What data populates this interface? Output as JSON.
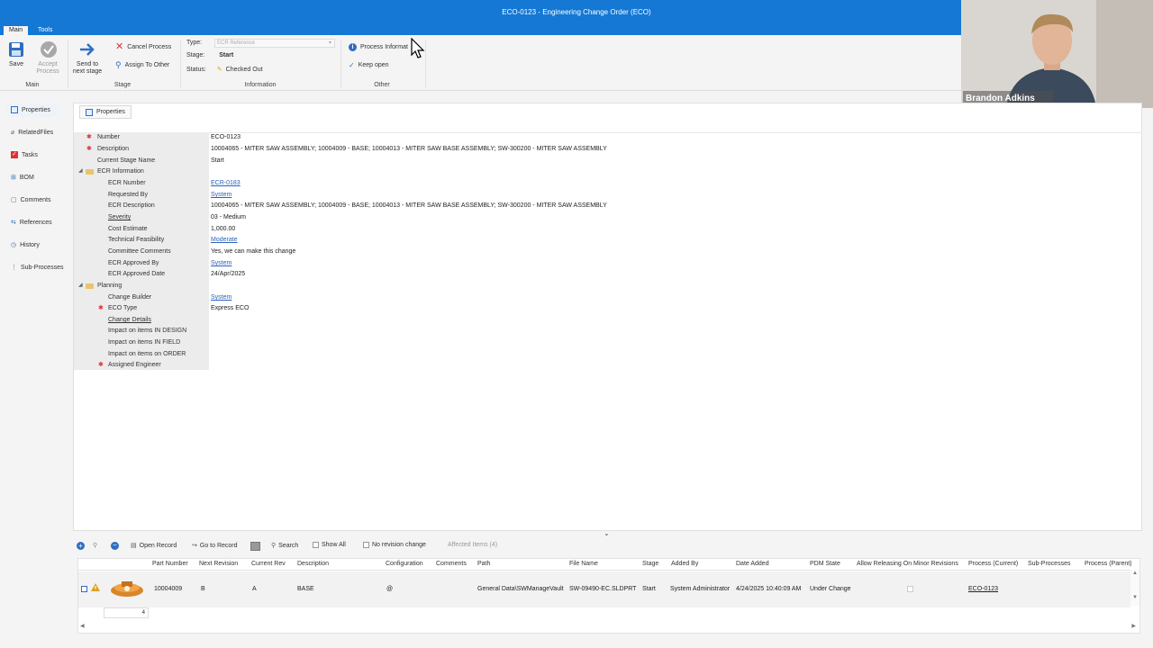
{
  "window": {
    "title": "ECO-0123 - Engineering Change Order (ECO)"
  },
  "menu_tabs": [
    "Main",
    "Tools"
  ],
  "ribbon": {
    "save": "Save",
    "accept": "Accept Process",
    "send": "Send to next stage",
    "cancel_process": "Cancel Process",
    "assign_other": "Assign To Other",
    "type_label": "Type:",
    "type_value": "ECR Reference",
    "stage_label": "Stage:",
    "stage_value": "Start",
    "status_label": "Status:",
    "status_value": "Checked Out",
    "process_info": "Process Informat",
    "keep_open": "Keep open",
    "groups": {
      "main": "Main",
      "stage": "Stage",
      "information": "Information",
      "other": "Other"
    }
  },
  "video": {
    "name": "Brandon Adkins"
  },
  "sidebar": {
    "items": [
      "Properties",
      "RelatedFiles",
      "Tasks",
      "BOM",
      "Comments",
      "References",
      "History",
      "Sub-Processes"
    ]
  },
  "properties_tab": "Properties",
  "props": {
    "number_lbl": "Number",
    "number_val": "ECO-0123",
    "desc_lbl": "Description",
    "desc_val": "10004065 - MITER SAW ASSEMBLY; 10004009 - BASE; 10004013 - MITER SAW BASE ASSEMBLY; SW-300200 - MITER SAW ASSEMBLY",
    "stage_lbl": "Current Stage Name",
    "stage_val": "Start",
    "ecr_info": "ECR Information",
    "ecr_num_lbl": "ECR Number",
    "ecr_num_val": "ECR-0183",
    "req_lbl": "Requested By",
    "req_val": "System",
    "ecr_desc_lbl": "ECR Description",
    "ecr_desc_val": "10004065 - MITER SAW ASSEMBLY; 10004009 - BASE; 10004013 - MITER SAW BASE ASSEMBLY; SW-300200 - MITER SAW ASSEMBLY",
    "sev_lbl": "Severity",
    "sev_val": "03 - Medium",
    "cost_lbl": "Cost Estimate",
    "cost_val": "1,000.00",
    "tech_lbl": "Technical Feasibility",
    "tech_val": "Moderate",
    "comm_lbl": "Committee Comments",
    "comm_val": "Yes, we can make this change",
    "appr_by_lbl": "ECR Approved By",
    "appr_by_val": "System",
    "appr_date_lbl": "ECR Approved Date",
    "appr_date_val": "24/Apr/2025",
    "planning": "Planning",
    "builder_lbl": "Change Builder",
    "builder_val": "System",
    "eco_type_lbl": "ECO Type",
    "eco_type_val": "Express ECO",
    "details_lbl": "Change Details",
    "imp_design": "Impact on items IN DESIGN",
    "imp_field": "Impact on items IN FIELD",
    "imp_order": "Impact on items on ORDER",
    "engineer": "Assigned Engineer"
  },
  "toolbar": {
    "open_record": "Open Record",
    "goto_record": "Go to Record",
    "search": "Search",
    "show_all": "Show All",
    "no_rev": "No revision change",
    "affected": "Affected Items (4)"
  },
  "grid": {
    "headers": [
      "Part Number",
      "Next Revision",
      "Current Rev",
      "Description",
      "Configuration",
      "Comments",
      "Path",
      "File Name",
      "Stage",
      "Added By",
      "Date Added",
      "PDM State",
      "Allow Releasing On Minor Revisions",
      "Process (Current)",
      "Sub-Processes",
      "Process (Parent)"
    ],
    "row": {
      "part": "10004009",
      "next_rev": "B",
      "cur_rev": "A",
      "desc": "BASE",
      "config": "@",
      "path": "General Data\\SWManageVault",
      "file": "SW-09490-EC.SLDPRT",
      "stage": "Start",
      "added_by": "System Administrator",
      "date": "4/24/2025 10:40:09 AM",
      "state": "Under Change",
      "process": "ECO-0123"
    },
    "count": "4"
  }
}
